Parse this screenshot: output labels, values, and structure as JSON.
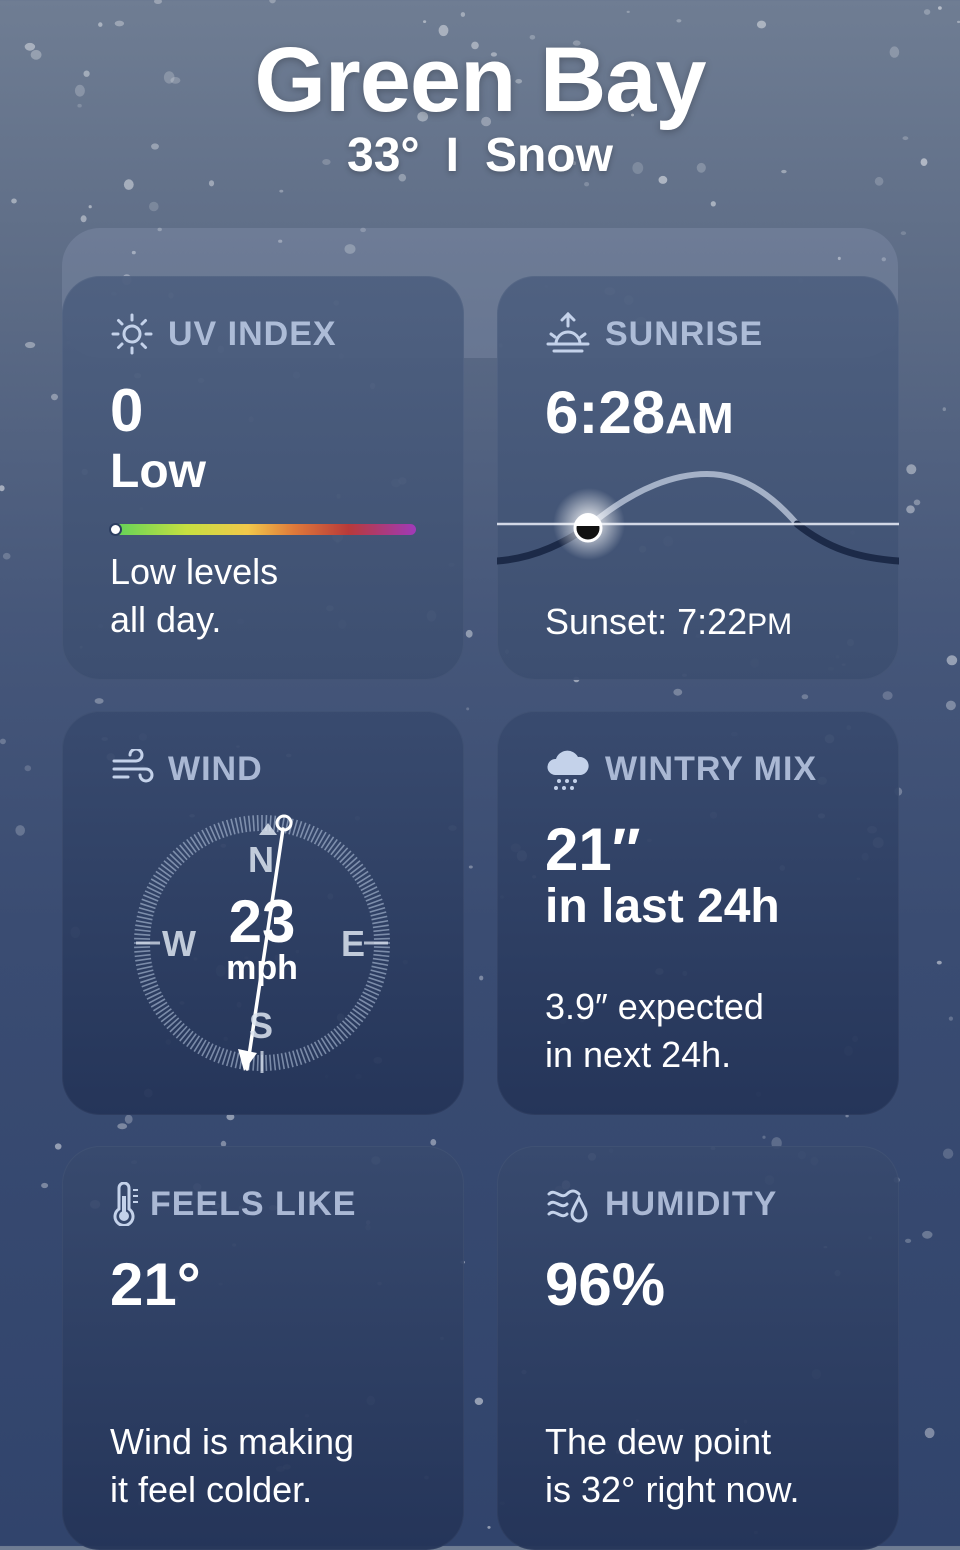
{
  "header": {
    "city": "Green Bay",
    "temperature": "33°",
    "separator": "I",
    "condition": "Snow"
  },
  "uv_index": {
    "title": "UV INDEX",
    "icon": "sun-icon",
    "value": "0",
    "level": "Low",
    "level_fraction": 0.0,
    "note_line1": "Low levels",
    "note_line2": "all day."
  },
  "sunrise": {
    "title": "SUNRISE",
    "icon": "sunrise-icon",
    "time": "6:28",
    "ampm": "AM",
    "sunset_label": "Sunset: 7:22",
    "sunset_ampm": "PM"
  },
  "wind": {
    "title": "WIND",
    "icon": "wind-icon",
    "speed": "23",
    "unit": "mph",
    "north": "N",
    "south": "S",
    "east": "E",
    "west": "W"
  },
  "wintry_mix": {
    "title": "WINTRY MIX",
    "icon": "cloud-sleet-icon",
    "amount": "21″",
    "period": "in last 24h",
    "note_line1": "3.9″ expected",
    "note_line2": "in next 24h."
  },
  "feels_like": {
    "title": "FEELS LIKE",
    "icon": "thermometer-icon",
    "value": "21°",
    "note_line1": "Wind is making",
    "note_line2": "it feel colder."
  },
  "humidity": {
    "title": "HUMIDITY",
    "icon": "humidity-icon",
    "value": "96%",
    "note_line1": "The dew point",
    "note_line2": "is 32° right now."
  }
}
